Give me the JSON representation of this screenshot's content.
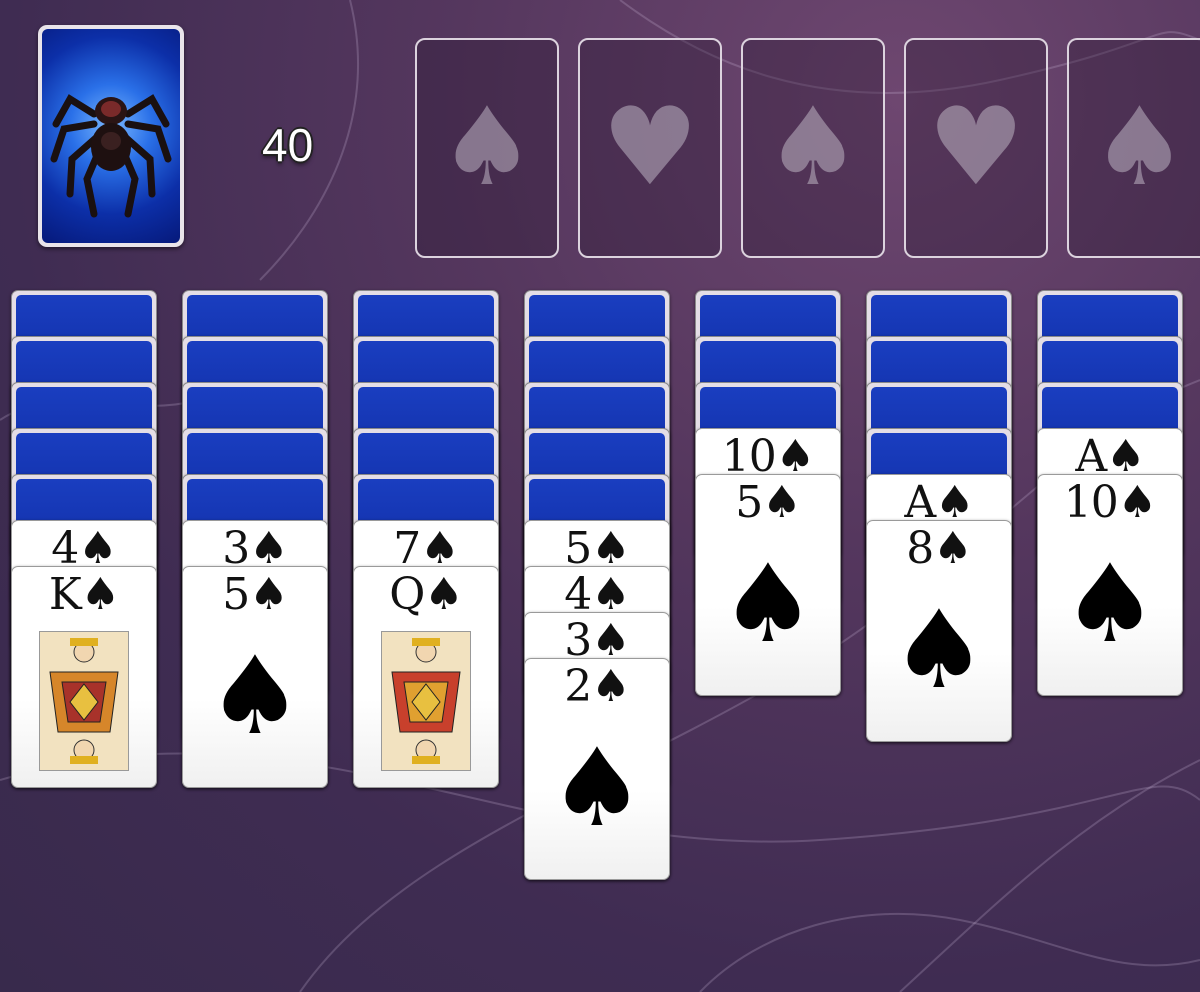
{
  "stock": {
    "remaining": "40",
    "icon": "tarantula-icon"
  },
  "foundations": [
    {
      "suit": "♠"
    },
    {
      "suit": "♥"
    },
    {
      "suit": "♠"
    },
    {
      "suit": "♥"
    },
    {
      "suit": "♠"
    }
  ],
  "tableau": [
    {
      "hidden": 5,
      "cards": [
        {
          "label": "4♠"
        },
        {
          "label": "K♠",
          "court": "king"
        }
      ]
    },
    {
      "hidden": 5,
      "cards": [
        {
          "label": "3♠"
        },
        {
          "label": "5♠"
        }
      ]
    },
    {
      "hidden": 5,
      "cards": [
        {
          "label": "7♠"
        },
        {
          "label": "Q♠",
          "court": "queen"
        }
      ]
    },
    {
      "hidden": 5,
      "cards": [
        {
          "label": "5♠"
        },
        {
          "label": "4♠"
        },
        {
          "label": "3♠"
        },
        {
          "label": "2♠"
        }
      ]
    },
    {
      "hidden": 3,
      "cards": [
        {
          "label": "10♠"
        },
        {
          "label": "5♠"
        }
      ]
    },
    {
      "hidden": 4,
      "cards": [
        {
          "label": "A♠"
        },
        {
          "label": "8♠"
        }
      ]
    },
    {
      "hidden": 3,
      "cards": [
        {
          "label": "A♠"
        },
        {
          "label": "10♠"
        }
      ]
    }
  ],
  "big_suit": "♠"
}
